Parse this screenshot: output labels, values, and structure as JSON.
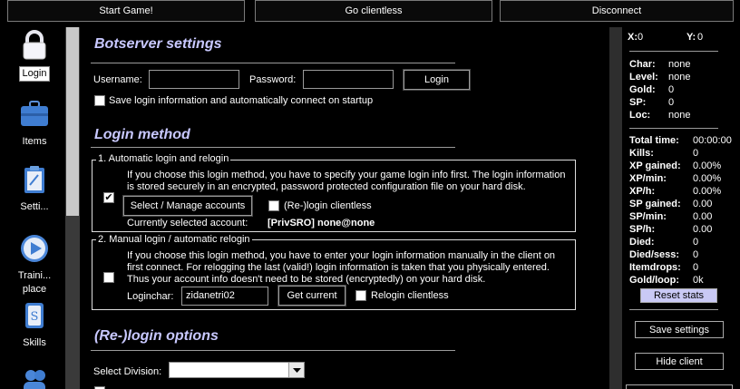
{
  "topbar": {
    "start_game": "Start Game!",
    "go_clientless": "Go clientless",
    "disconnect": "Disconnect"
  },
  "nav": {
    "items": [
      {
        "label": "Login",
        "icon": "lock-icon"
      },
      {
        "label": "Items",
        "icon": "briefcase-icon"
      },
      {
        "label": "Setti...",
        "icon": "clipboard-icon"
      },
      {
        "label": "Traini... place",
        "icon": "play-icon"
      },
      {
        "label": "Skills",
        "icon": "skill-book-icon"
      }
    ]
  },
  "botserver": {
    "title": "Botserver settings",
    "username_label": "Username:",
    "username_value": "",
    "password_label": "Password:",
    "password_value": "",
    "login_button": "Login",
    "save_login_label": "Save login information and automatically connect on startup",
    "save_login_checked": false
  },
  "login_method": {
    "title": "Login method",
    "auto": {
      "legend": "1. Automatic login and relogin",
      "desc_line1": "If you choose this login method, you have to specify your game login info first. The login information",
      "desc_line2": "is stored securely in an encrypted, password protected configuration file on your hard disk.",
      "checked": true,
      "select_button": "Select / Manage accounts",
      "relogin_clientless_label": "(Re-)login clientless",
      "relogin_clientless_checked": false,
      "current_account_label": "Currently selected account:",
      "current_account_value": "[PrivSRO] none@none"
    },
    "manual": {
      "legend": "2. Manual login / automatic relogin",
      "desc_line1": "If you choose this login method, you have to enter your login information manually in the client on",
      "desc_line2": "first connect. For relogging the last (valid!) login information is taken that you physically entered.",
      "desc_line3": "Thus your account info doesn't need to be stored (encryptedly) on your hard disk.",
      "checked": false,
      "loginchar_label": "Loginchar:",
      "loginchar_value": "zidanetri02",
      "get_current_button": "Get current",
      "relogin_clientless_label": "Relogin clientless",
      "relogin_clientless_checked": false
    }
  },
  "relogin_options": {
    "title": "(Re-)login options",
    "division_label": "Select Division:",
    "division_value": ""
  },
  "status": {
    "x_label": "X:",
    "x_value": "0",
    "y_label": "Y:",
    "y_value": "0",
    "char_label": "Char:",
    "char_value": "none",
    "level_label": "Level:",
    "level_value": "none",
    "gold_label": "Gold:",
    "gold_value": "0",
    "sp_label": "SP:",
    "sp_value": "0",
    "loc_label": "Loc:",
    "loc_value": "none"
  },
  "stats": {
    "total_time_label": "Total time:",
    "total_time_value": "00:00:00",
    "kills_label": "Kills:",
    "kills_value": "0",
    "xp_gained_label": "XP gained:",
    "xp_gained_value": "0.00%",
    "xp_min_label": "XP/min:",
    "xp_min_value": "0.00%",
    "xp_h_label": "XP/h:",
    "xp_h_value": "0.00%",
    "sp_gained_label": "SP gained:",
    "sp_gained_value": "0.00",
    "sp_min_label": "SP/min:",
    "sp_min_value": "0.00",
    "sp_h_label": "SP/h:",
    "sp_h_value": "0.00",
    "died_label": "Died:",
    "died_value": "0",
    "died_sess_label": "Died/sess:",
    "died_sess_value": "0",
    "itemdrops_label": "Itemdrops:",
    "itemdrops_value": "0",
    "gold_loop_label": "Gold/loop:",
    "gold_loop_value": "0k",
    "reset_button": "Reset stats"
  },
  "actions": {
    "save_settings": "Save settings",
    "hide_client": "Hide client"
  },
  "colors": {
    "heading": "#c8c8ff",
    "background": "#000000",
    "reset_button_bg": "#c9c9f5"
  }
}
